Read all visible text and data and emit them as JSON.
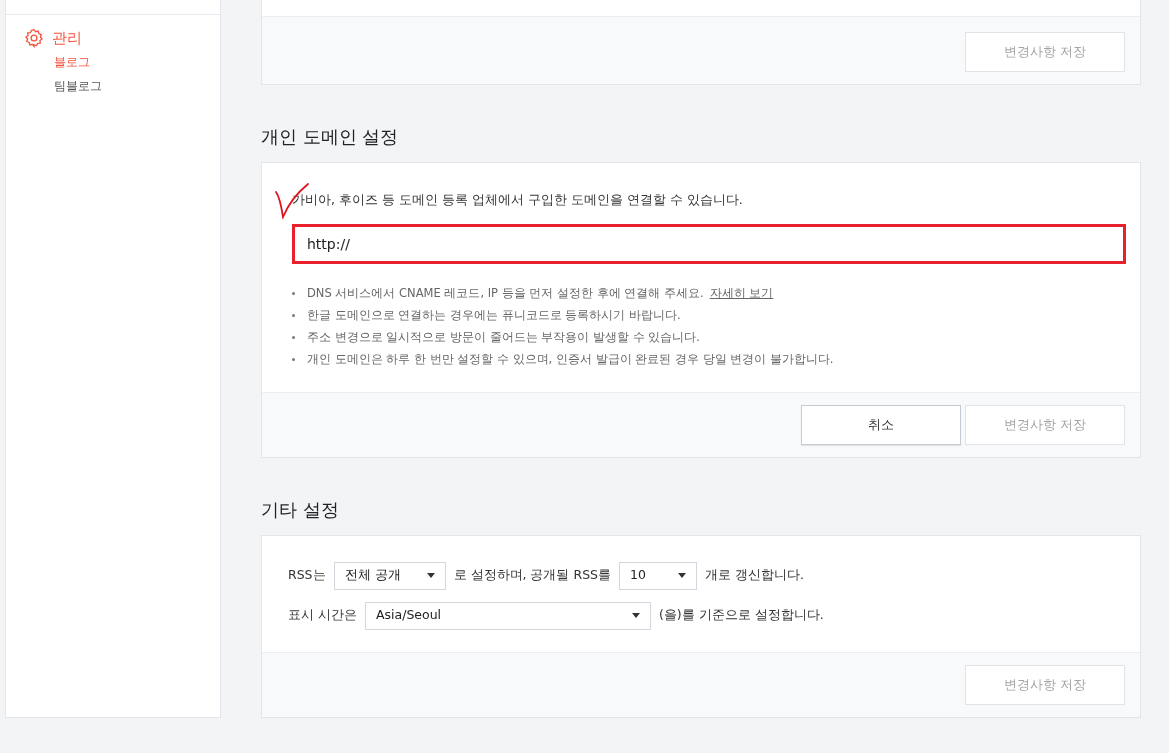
{
  "sidebar": {
    "section": {
      "label": "관리",
      "items": [
        {
          "label": "블로그",
          "selected": true
        },
        {
          "label": "팀블로그",
          "selected": false
        }
      ]
    }
  },
  "top_card": {
    "buttons": [
      {
        "label": "변경사항 저장",
        "disabled": true
      }
    ]
  },
  "domain_section": {
    "title": "개인 도메인 설정",
    "description": "가비아, 후이즈 등 도메인 등록 업체에서 구입한 도메인을 연결할 수 있습니다.",
    "input": {
      "value": "http://"
    },
    "notes": [
      {
        "text": "DNS 서비스에서 CNAME 레코드, IP 등을 먼저 설정한 후에 연결해 주세요.",
        "link": "자세히 보기"
      },
      {
        "text": "한글 도메인으로 연결하는 경우에는 퓨니코드로 등록하시기 바랍니다."
      },
      {
        "text": "주소 변경으로 일시적으로 방문이 줄어드는 부작용이 발생할 수 있습니다."
      },
      {
        "text": "개인 도메인은 하루 한 번만 설정할 수 있으며, 인증서 발급이 완료된 경우 당일 변경이 불가합니다."
      }
    ],
    "buttons": [
      {
        "label": "취소",
        "disabled": false
      },
      {
        "label": "변경사항 저장",
        "disabled": true
      }
    ]
  },
  "other_section": {
    "title": "기타 설정",
    "settings": [
      {
        "parts": [
          {
            "kind": "text",
            "text": "RSS는"
          },
          {
            "kind": "select",
            "value": "전체 공개"
          },
          {
            "kind": "text",
            "text": "로 설정하며, 공개될 RSS를"
          },
          {
            "kind": "select",
            "value": "10"
          },
          {
            "kind": "text",
            "text": "개로 갱신합니다."
          }
        ]
      },
      {
        "parts": [
          {
            "kind": "text",
            "text": "표시 시간은"
          },
          {
            "kind": "select",
            "value": "Asia/Seoul"
          },
          {
            "kind": "text",
            "text": "(을)를 기준으로 설정합니다."
          }
        ]
      }
    ],
    "buttons": [
      {
        "label": "변경사항 저장",
        "disabled": true
      }
    ]
  },
  "annotations": {
    "check_mark": true,
    "highlight_input": true
  }
}
